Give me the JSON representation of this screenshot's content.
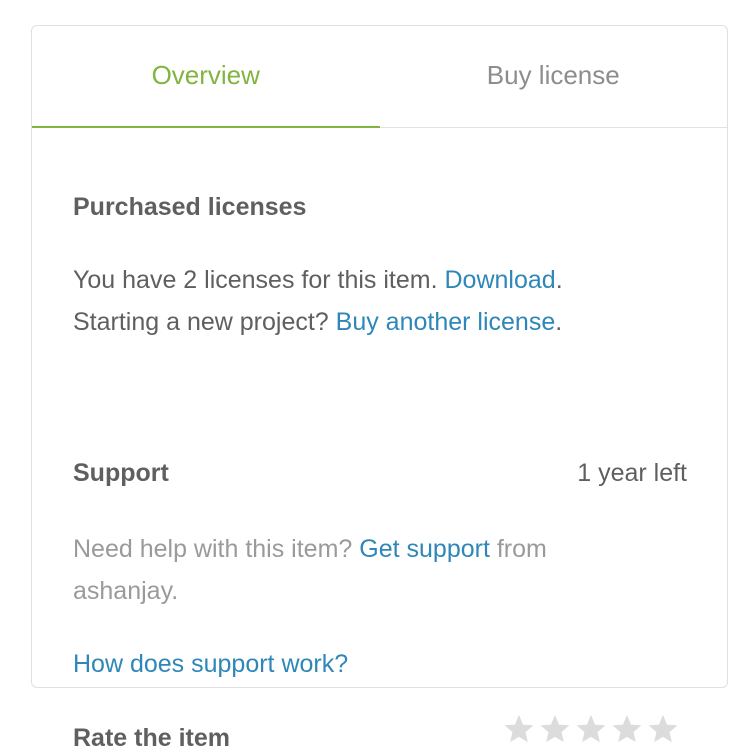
{
  "tabs": [
    {
      "label": "Overview",
      "active": true
    },
    {
      "label": "Buy license",
      "active": false
    }
  ],
  "purchased": {
    "title": "Purchased licenses",
    "line1_text": "You have 2 licenses for this item. ",
    "line1_link": "Download",
    "line1_end": ".",
    "line2_text": "Starting a new project? ",
    "line2_link": "Buy another license",
    "line2_end": "."
  },
  "support": {
    "title": "Support",
    "status": "1 year left",
    "help_text": "Need help with this item? ",
    "help_link": "Get support",
    "help_suffix": " from",
    "author": "ashanjay.",
    "how_link": "How does support work?"
  },
  "rating": {
    "title": "Rate the item",
    "max_stars": 5,
    "current": 0,
    "star_color": "#dcdcdc"
  },
  "colors": {
    "accent": "#82b440",
    "link": "#2e87b8",
    "text": "#5f5f5f",
    "muted": "#9a9a9a"
  }
}
